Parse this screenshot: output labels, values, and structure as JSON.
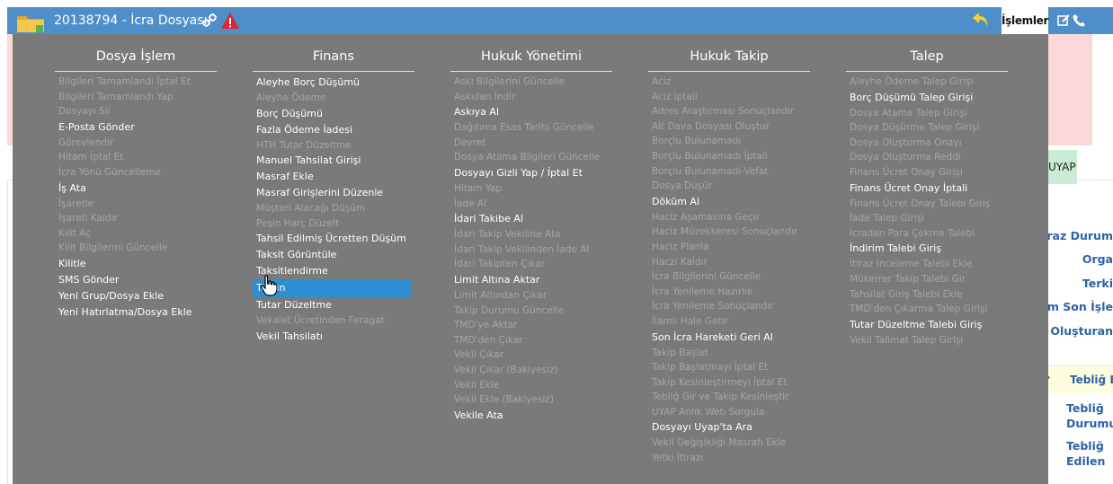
{
  "header": {
    "file_title": "20138794 - İcra Dosyası",
    "actions_label": "İşlemler"
  },
  "background": {
    "uyap_tab": "UYAP",
    "right_labels": [
      "İtiraz Durum",
      "Orga",
      "Terki",
      "üşüm Son İşle",
      "Oluşturan"
    ],
    "tebligat_tab": "Tebliğ E",
    "tebligat_labels": [
      "Tebliğ Durumu",
      "Tebliğ Edilen"
    ]
  },
  "menu": {
    "columns": [
      {
        "title": "Dosya İşlem",
        "items": [
          {
            "label": "Bilgileri Tamamlandı İptal Et",
            "enabled": false
          },
          {
            "label": "Bilgileri Tamamlandı Yap",
            "enabled": false
          },
          {
            "label": "Dosyayı Sil",
            "enabled": false
          },
          {
            "label": "E-Posta Gönder",
            "enabled": true
          },
          {
            "label": "Görevlendir",
            "enabled": false
          },
          {
            "label": "Hitam İptal Et",
            "enabled": false
          },
          {
            "label": "İcra Yönü Güncelleme",
            "enabled": false
          },
          {
            "label": "İş Ata",
            "enabled": true
          },
          {
            "label": "İşaretle",
            "enabled": false
          },
          {
            "label": "İşareti Kaldır",
            "enabled": false
          },
          {
            "label": "Kilit Aç",
            "enabled": false
          },
          {
            "label": "Kilit Bilgilerini Güncelle",
            "enabled": false
          },
          {
            "label": "Kilitle",
            "enabled": true
          },
          {
            "label": "SMS Gönder",
            "enabled": true
          },
          {
            "label": "Yeni Grup/Dosya Ekle",
            "enabled": true
          },
          {
            "label": "Yeni Hatırlatma/Dosya Ekle",
            "enabled": true
          }
        ]
      },
      {
        "title": "Finans",
        "items": [
          {
            "label": "Aleyhe Borç Düşümü",
            "enabled": true
          },
          {
            "label": "Aleyhe Ödeme",
            "enabled": false
          },
          {
            "label": "Borç Düşümü",
            "enabled": true
          },
          {
            "label": "Fazla Ödeme İadesi",
            "enabled": true
          },
          {
            "label": "HTH Tutar Düzeltme",
            "enabled": false
          },
          {
            "label": "Manuel Tahsilat Girişi",
            "enabled": true
          },
          {
            "label": "Masraf Ekle",
            "enabled": true
          },
          {
            "label": "Masraf Girişlerini Düzenle",
            "enabled": true
          },
          {
            "label": "Müşteri Alacağı Düşüm",
            "enabled": false
          },
          {
            "label": "Peşin Harç Düzelt",
            "enabled": false
          },
          {
            "label": "Tahsil Edilmiş Ücretten Düşüm",
            "enabled": true
          },
          {
            "label": "Taksit Görüntüle",
            "enabled": true
          },
          {
            "label": "Taksitlendirme",
            "enabled": true
          },
          {
            "label": "Terkin",
            "enabled": true,
            "selected": true
          },
          {
            "label": "Tutar Düzeltme",
            "enabled": true
          },
          {
            "label": "Vekalet Ücretinden Feragat",
            "enabled": false
          },
          {
            "label": "Vekil Tahsilatı",
            "enabled": true
          }
        ]
      },
      {
        "title": "Hukuk Yönetimi",
        "items": [
          {
            "label": "Askı Bilgilerini Güncelle",
            "enabled": false
          },
          {
            "label": "Askıdan İndir",
            "enabled": false
          },
          {
            "label": "Askıya Al",
            "enabled": true
          },
          {
            "label": "Dağıtıma Esas Tarihi Güncelle",
            "enabled": false
          },
          {
            "label": "Devret",
            "enabled": false
          },
          {
            "label": "Dosya Atama Bilgileri Güncelle",
            "enabled": false
          },
          {
            "label": "Dosyayı Gizli Yap / İptal Et",
            "enabled": true
          },
          {
            "label": "Hitam Yap",
            "enabled": false
          },
          {
            "label": "İade Al",
            "enabled": false
          },
          {
            "label": "İdari Takibe Al",
            "enabled": true
          },
          {
            "label": "İdari Takip Vekiline Ata",
            "enabled": false
          },
          {
            "label": "İdari Takip Vekilinden İade Al",
            "enabled": false
          },
          {
            "label": "İdari Takipten Çıkar",
            "enabled": false
          },
          {
            "label": "Limit Altına Aktar",
            "enabled": true
          },
          {
            "label": "Limit Altından Çıkar",
            "enabled": false
          },
          {
            "label": "Takip Durumu Güncelle",
            "enabled": false
          },
          {
            "label": "TMD'ye Aktar",
            "enabled": false
          },
          {
            "label": "TMD'den Çıkar",
            "enabled": false
          },
          {
            "label": "Vekil Çıkar",
            "enabled": false
          },
          {
            "label": "Vekil Çıkar (Bakiyesiz)",
            "enabled": false
          },
          {
            "label": "Vekil Ekle",
            "enabled": false
          },
          {
            "label": "Vekil Ekle (Bakiyesiz)",
            "enabled": false
          },
          {
            "label": "Vekile Ata",
            "enabled": true
          }
        ]
      },
      {
        "title": "Hukuk Takip",
        "items": [
          {
            "label": "Aciz",
            "enabled": false
          },
          {
            "label": "Aciz İptali",
            "enabled": false
          },
          {
            "label": "Adres Araştırması Sonuçlandır",
            "enabled": false
          },
          {
            "label": "Alt Dava Dosyası Oluştur",
            "enabled": false
          },
          {
            "label": "Borçlu Bulunamadı",
            "enabled": false
          },
          {
            "label": "Borçlu Bulunamadı İptali",
            "enabled": false
          },
          {
            "label": "Borçlu Bulunamadı-Vefat",
            "enabled": false
          },
          {
            "label": "Dosya Düşür",
            "enabled": false
          },
          {
            "label": "Döküm Al",
            "enabled": true
          },
          {
            "label": "Haciz Aşamasına Geçir",
            "enabled": false
          },
          {
            "label": "Haciz Müzekkeresi Sonuçlandır",
            "enabled": false
          },
          {
            "label": "Haciz Planla",
            "enabled": false
          },
          {
            "label": "Haczi Kaldır",
            "enabled": false
          },
          {
            "label": "İcra Bilgilerini Güncelle",
            "enabled": false
          },
          {
            "label": "İcra Yenileme Hazırlık",
            "enabled": false
          },
          {
            "label": "İcra Yenileme Sonuçlandır",
            "enabled": false
          },
          {
            "label": "İlamlı Hale Getir",
            "enabled": false
          },
          {
            "label": "Son İcra Hareketi Geri Al",
            "enabled": true
          },
          {
            "label": "Takip Başlat",
            "enabled": false
          },
          {
            "label": "Takip Başlatmayı İptal Et",
            "enabled": false
          },
          {
            "label": "Takip Kesinleştirmeyi İptal Et",
            "enabled": false
          },
          {
            "label": "Tebliğ Gir ve Takip Kesinleştir",
            "enabled": false
          },
          {
            "label": "UYAP Anlık Web Sorgula",
            "enabled": false
          },
          {
            "label": "Dosyayı Uyap'ta Ara",
            "enabled": true
          },
          {
            "label": "Vekil Değişikliği Masrafı Ekle",
            "enabled": false
          },
          {
            "label": "Yetki İtirazı",
            "enabled": false
          }
        ]
      },
      {
        "title": "Talep",
        "items": [
          {
            "label": "Aleyhe Ödeme Talep Girişi",
            "enabled": false
          },
          {
            "label": "Borç Düşümü Talep Girişi",
            "enabled": true
          },
          {
            "label": "Dosya Atama Talep Girişi",
            "enabled": false
          },
          {
            "label": "Dosya Düşürme Talep Girişi",
            "enabled": false
          },
          {
            "label": "Dosya Oluşturma Onayı",
            "enabled": false
          },
          {
            "label": "Dosya Oluşturma Reddi",
            "enabled": false
          },
          {
            "label": "Finans Ücret Onay Girişi",
            "enabled": false
          },
          {
            "label": "Finans Ücret Onay İptali",
            "enabled": true
          },
          {
            "label": "Finans Ücret Onay Talebi Giriş",
            "enabled": false
          },
          {
            "label": "İade Talep Girişi",
            "enabled": false
          },
          {
            "label": "İcradan Para Çekme Talebi",
            "enabled": false
          },
          {
            "label": "İndirim Talebi Giriş",
            "enabled": true
          },
          {
            "label": "İtiraz İnceleme Talebi Ekle",
            "enabled": false
          },
          {
            "label": "Mükerrer Takip Talebi Gir",
            "enabled": false
          },
          {
            "label": "Tahsilat Giriş Talebi Ekle",
            "enabled": false
          },
          {
            "label": "TMD'den Çıkarma Talep Girişi",
            "enabled": false
          },
          {
            "label": "Tutar Düzeltme Talebi Giriş",
            "enabled": true
          },
          {
            "label": "Vekil Talimat Talep Girişi",
            "enabled": false
          }
        ]
      }
    ]
  }
}
